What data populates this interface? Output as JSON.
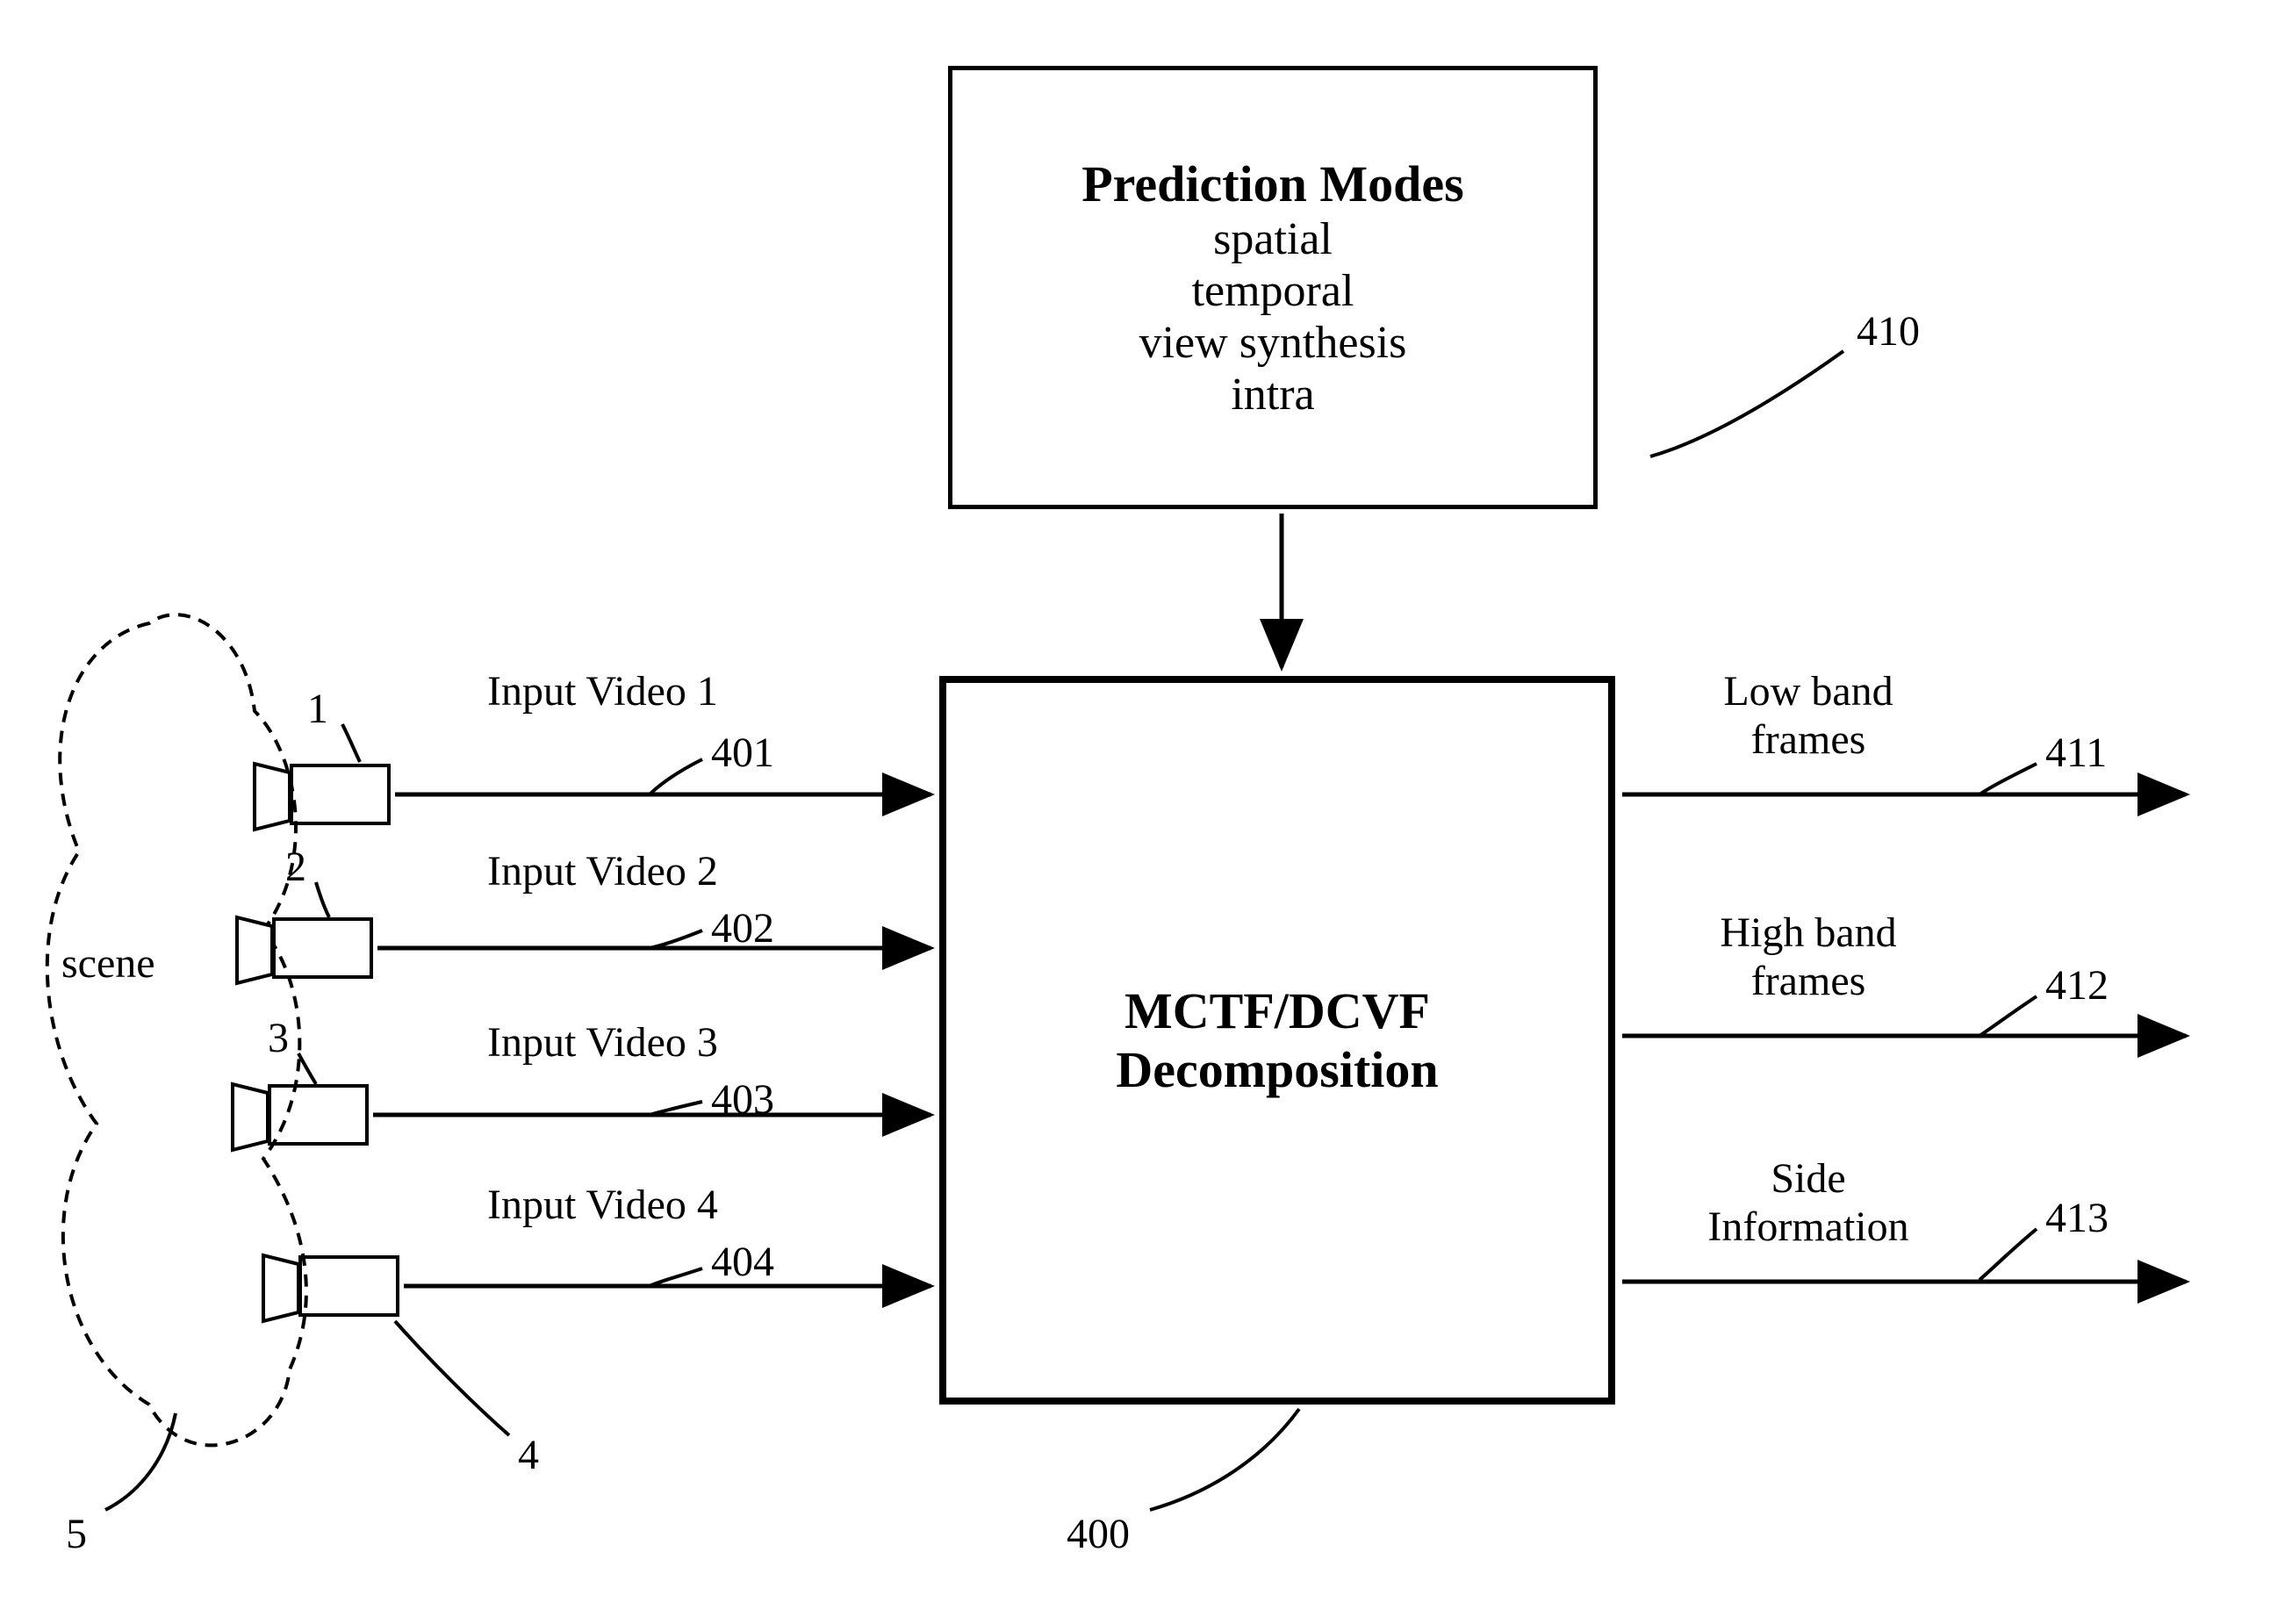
{
  "prediction_box": {
    "title": "Prediction Modes",
    "line1": "spatial",
    "line2": "temporal",
    "line3": "view synthesis",
    "line4": "intra"
  },
  "prediction_ref": "410",
  "main_box": {
    "line1": "MCTF/DCVF",
    "line2": "Decomposition"
  },
  "main_ref": "400",
  "scene_label": "scene",
  "scene_ref": "5",
  "cameras": {
    "c1": "1",
    "c2": "2",
    "c3": "3",
    "c4": "4"
  },
  "inputs": {
    "i1": {
      "label": "Input Video 1",
      "ref": "401"
    },
    "i2": {
      "label": "Input Video 2",
      "ref": "402"
    },
    "i3": {
      "label": "Input Video 3",
      "ref": "403"
    },
    "i4": {
      "label": "Input Video 4",
      "ref": "404"
    }
  },
  "outputs": {
    "o1": {
      "label_l1": "Low band",
      "label_l2": "frames",
      "ref": "411"
    },
    "o2": {
      "label_l1": "High band",
      "label_l2": "frames",
      "ref": "412"
    },
    "o3": {
      "label_l1": "Side",
      "label_l2": "Information",
      "ref": "413"
    }
  }
}
